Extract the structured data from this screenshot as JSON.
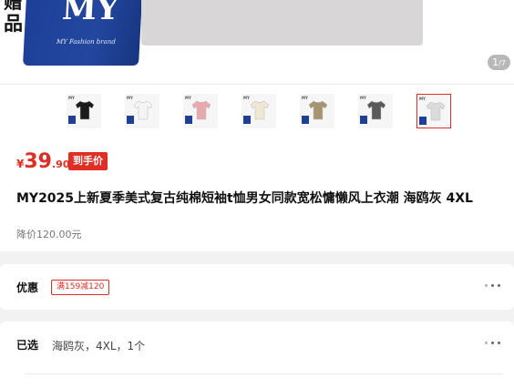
{
  "hero": {
    "tag_text": "赠品",
    "bag_logo": "MY",
    "bag_brand": "MY Fashion brand",
    "counter_current": "1",
    "counter_total": "/7"
  },
  "thumbnails": [
    {
      "color": "#1b1b1b",
      "logo": "MY",
      "selected": false
    },
    {
      "color": "#f4f4f4",
      "logo": "MY",
      "selected": false
    },
    {
      "color": "#e8a9ad",
      "logo": "MY",
      "selected": false
    },
    {
      "color": "#efe6d4",
      "logo": "MY",
      "selected": false
    },
    {
      "color": "#a69473",
      "logo": "MY",
      "selected": false
    },
    {
      "color": "#5a5a5a",
      "logo": "MY",
      "selected": false
    },
    {
      "color": "#dcdbdb",
      "logo": "MY",
      "selected": true
    }
  ],
  "price": {
    "currency": "¥",
    "integer": "39",
    "decimal": ".90",
    "badge": "到手价"
  },
  "product": {
    "title": "MY2025上新夏季美式复古纯棉短袖t恤男女同款宽松慵懒风上衣潮 海鸥灰 4XL",
    "original_price": "降价120.00元"
  },
  "coupon": {
    "label": "优惠",
    "tag": "满159减120"
  },
  "selection": {
    "label": "已选",
    "value": "海鸥灰，4XL，1个"
  },
  "colors": {
    "accent": "#e02e24"
  }
}
